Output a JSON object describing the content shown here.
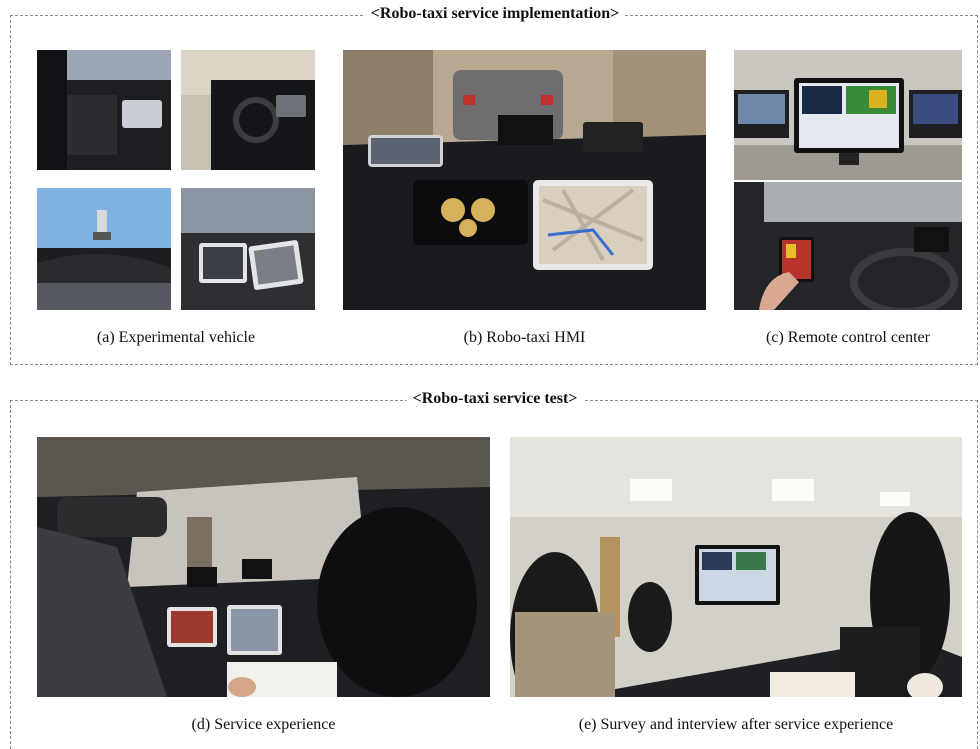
{
  "sections": {
    "implementation_title": "<Robo-taxi service implementation>",
    "test_title": "<Robo-taxi service test>"
  },
  "captions": {
    "a": "(a) Experimental vehicle",
    "b": "(b) Robo-taxi HMI",
    "c": "(c) Remote control center",
    "d": "(d) Service experience",
    "e": "(e) Survey and interview after service experience"
  }
}
